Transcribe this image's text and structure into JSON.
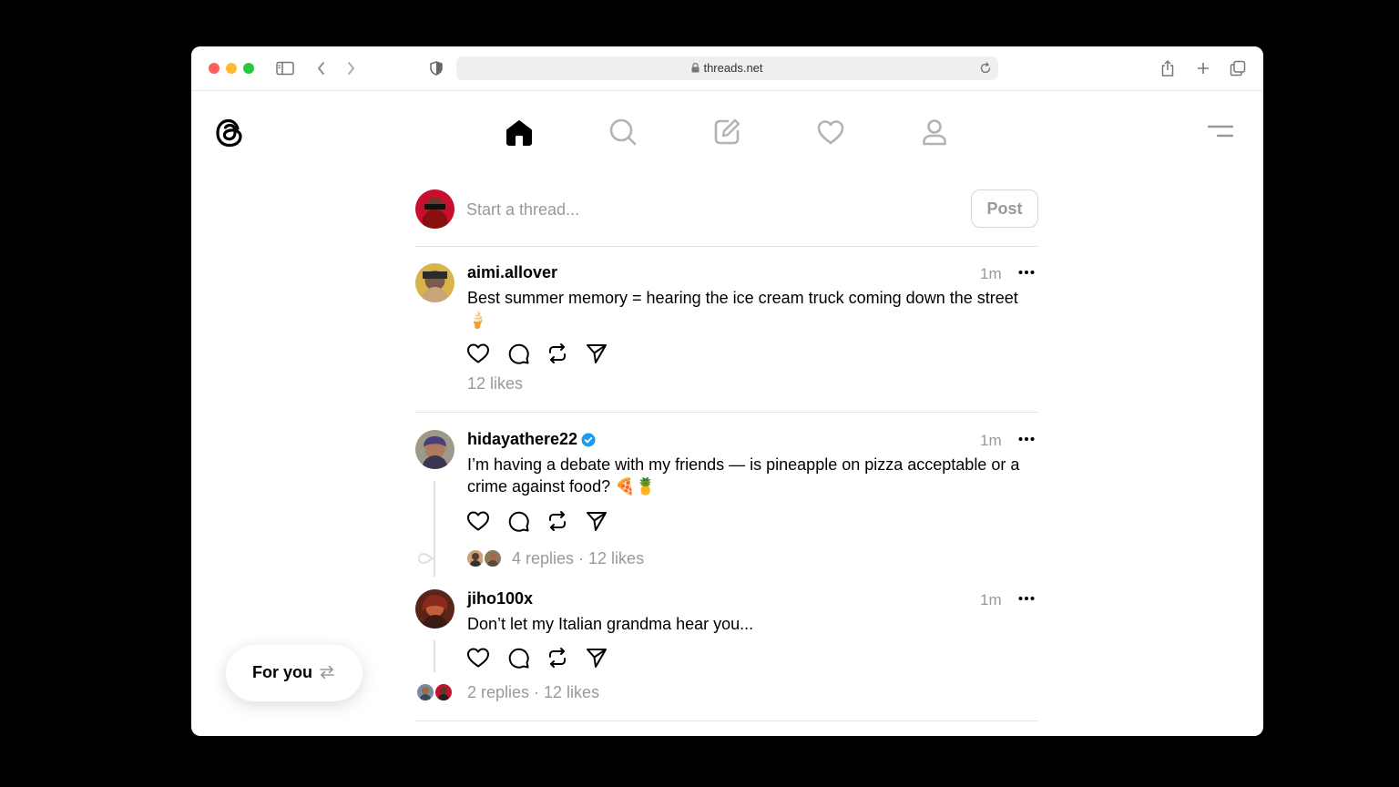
{
  "browser": {
    "url": "threads.net"
  },
  "nav": {
    "icons": [
      "threads-logo",
      "home-icon",
      "search-icon",
      "compose-icon",
      "heart-icon",
      "profile-icon",
      "menu-icon"
    ]
  },
  "composer": {
    "placeholder": "Start a thread...",
    "post_label": "Post"
  },
  "posts": [
    {
      "username": "aimi.allover",
      "verified": false,
      "time": "1m",
      "text": "Best summer memory = hearing the ice cream truck coming down the street 🍦",
      "stats": "12 likes"
    },
    {
      "username": "hidayathere22",
      "verified": true,
      "time": "1m",
      "text": "I’m having a debate with my friends — is pineapple on pizza acceptable or a crime against food? 🍕🍍",
      "stats": "4 replies · 12 likes"
    },
    {
      "username": "jiho100x",
      "verified": false,
      "time": "1m",
      "text": "Don’t let my Italian grandma hear you...",
      "stats": "2 replies · 12 likes"
    }
  ],
  "feed_switcher": {
    "label": "For you"
  },
  "colors": {
    "verified": "#1d9bf0",
    "muted_text": "#999999",
    "divider": "#e3e3e3"
  }
}
